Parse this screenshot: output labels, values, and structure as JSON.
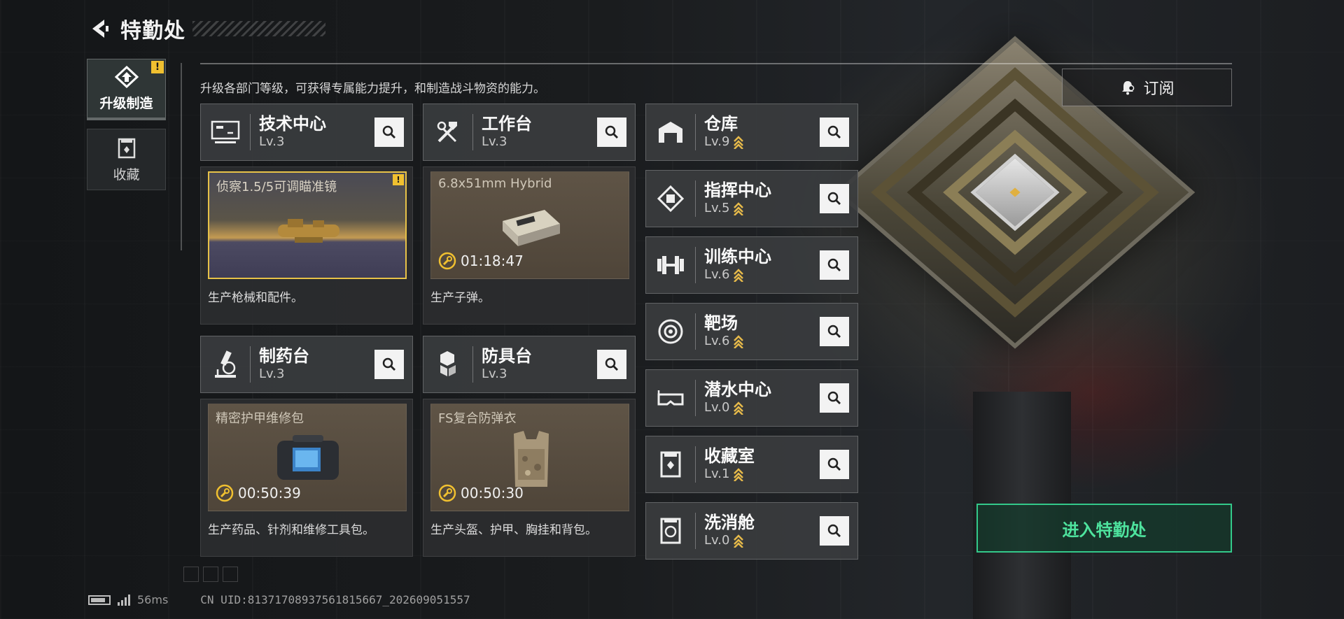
{
  "header": {
    "title": "特勤处",
    "back_icon": "back-arrow-icon"
  },
  "nav": [
    {
      "label": "升级制造",
      "icon": "upgrade-build-icon",
      "active": true,
      "alert": "!"
    },
    {
      "label": "收藏",
      "icon": "collection-icon",
      "active": false
    }
  ],
  "description": "升级各部门等级，可获得专属能力提升，和制造战斗物资的能力。",
  "subscribe": {
    "label": "订阅",
    "icon": "bell-icon"
  },
  "stations": [
    {
      "name": "技术中心",
      "level": "Lv.3",
      "icon": "monitor-icon",
      "product": {
        "name": "侦察1.5/5可调瞄准镜",
        "timer": "",
        "alert": "!"
      },
      "desc": "生产枪械和配件。"
    },
    {
      "name": "工作台",
      "level": "Lv.3",
      "icon": "tools-icon",
      "product": {
        "name": "6.8x51mm Hybrid",
        "timer": "01:18:47"
      },
      "desc": "生产子弹。"
    },
    {
      "name": "制药台",
      "level": "Lv.3",
      "icon": "microscope-icon",
      "product": {
        "name": "精密护甲维修包",
        "timer": "00:50:39"
      },
      "desc": "生产药品、针剂和维修工具包。"
    },
    {
      "name": "防具台",
      "level": "Lv.3",
      "icon": "armor-blocks-icon",
      "product": {
        "name": "FS复合防弹衣",
        "timer": "00:50:30"
      },
      "desc": "生产头盔、护甲、胸挂和背包。"
    }
  ],
  "mini_stations": [
    {
      "name": "仓库",
      "level": "Lv.9",
      "icon": "warehouse-icon"
    },
    {
      "name": "指挥中心",
      "level": "Lv.5",
      "icon": "command-chip-icon"
    },
    {
      "name": "训练中心",
      "level": "Lv.6",
      "icon": "dumbbell-icon"
    },
    {
      "name": "靶场",
      "level": "Lv.6",
      "icon": "target-icon"
    },
    {
      "name": "潜水中心",
      "level": "Lv.0",
      "icon": "diving-mask-icon"
    },
    {
      "name": "收藏室",
      "level": "Lv.1",
      "icon": "collection-room-icon"
    },
    {
      "name": "洗消舱",
      "level": "Lv.0",
      "icon": "decon-icon"
    }
  ],
  "enter_button": "进入特勤处",
  "footer": {
    "ping": "56ms",
    "uid": "CN UID:8137170893756181566​7_202609051557"
  },
  "colors": {
    "accent_green": "#33c98a",
    "alert_yellow": "#f0c030",
    "upgrade_gold": "#e6b94a"
  }
}
